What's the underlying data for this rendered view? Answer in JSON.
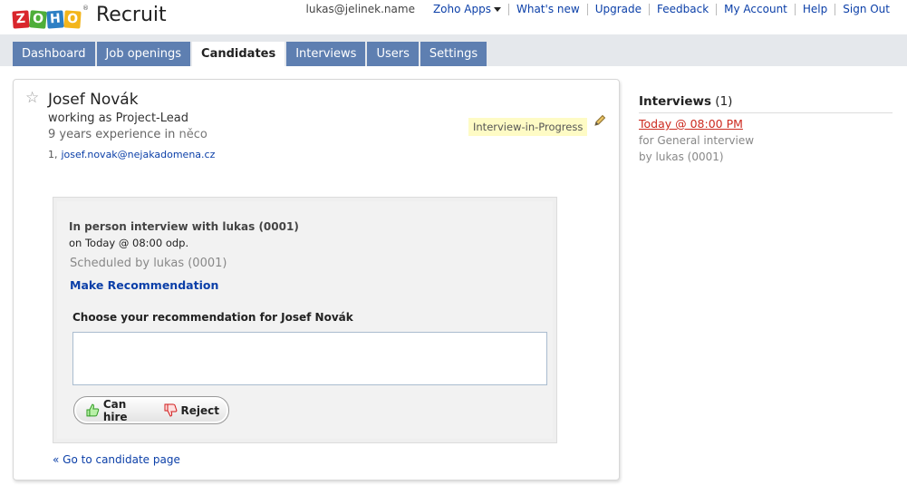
{
  "header": {
    "logo_letters": [
      "Z",
      "O",
      "H",
      "O"
    ],
    "logo_reg": "®",
    "app_name": "Recruit",
    "user": "lukas@jelinek.name",
    "links": {
      "zoho_apps": "Zoho Apps",
      "whats_new": "What's new",
      "upgrade": "Upgrade",
      "feedback": "Feedback",
      "my_account": "My Account",
      "help": "Help",
      "sign_out": "Sign Out"
    }
  },
  "tabs": {
    "dashboard": "Dashboard",
    "job_openings": "Job openings",
    "candidates": "Candidates",
    "interviews": "Interviews",
    "users": "Users",
    "settings": "Settings",
    "active": "Candidates"
  },
  "candidate": {
    "name": "Josef Novák",
    "role": "working as Project-Lead",
    "experience": "9 years experience in",
    "skill": "něco",
    "contact_prefix": "1,",
    "email": "josef.novak@nejakadomena.cz",
    "status": "Interview-in-Progress"
  },
  "interview": {
    "title": "In person interview with lukas (0001)",
    "when": "on Today @ 08:00 odp.",
    "scheduled_by": "Scheduled by lukas (0001)",
    "make_recommendation": "Make Recommendation",
    "choose_prompt": "Choose your recommendation for Josef Novák",
    "recommendation_value": "",
    "can_hire": "Can hire",
    "reject": "Reject"
  },
  "goto_link": "« Go to candidate page",
  "side": {
    "heading": "Interviews",
    "count": "(1)",
    "time": "Today @ 08:00 PM",
    "for": "for General interview",
    "by": "by lukas (0001)"
  },
  "colors": {
    "tab_bg": "#5e7fb1",
    "link": "#0b3fa8",
    "status_bg": "#fefbc5",
    "side_time": "#cc2a1f"
  }
}
